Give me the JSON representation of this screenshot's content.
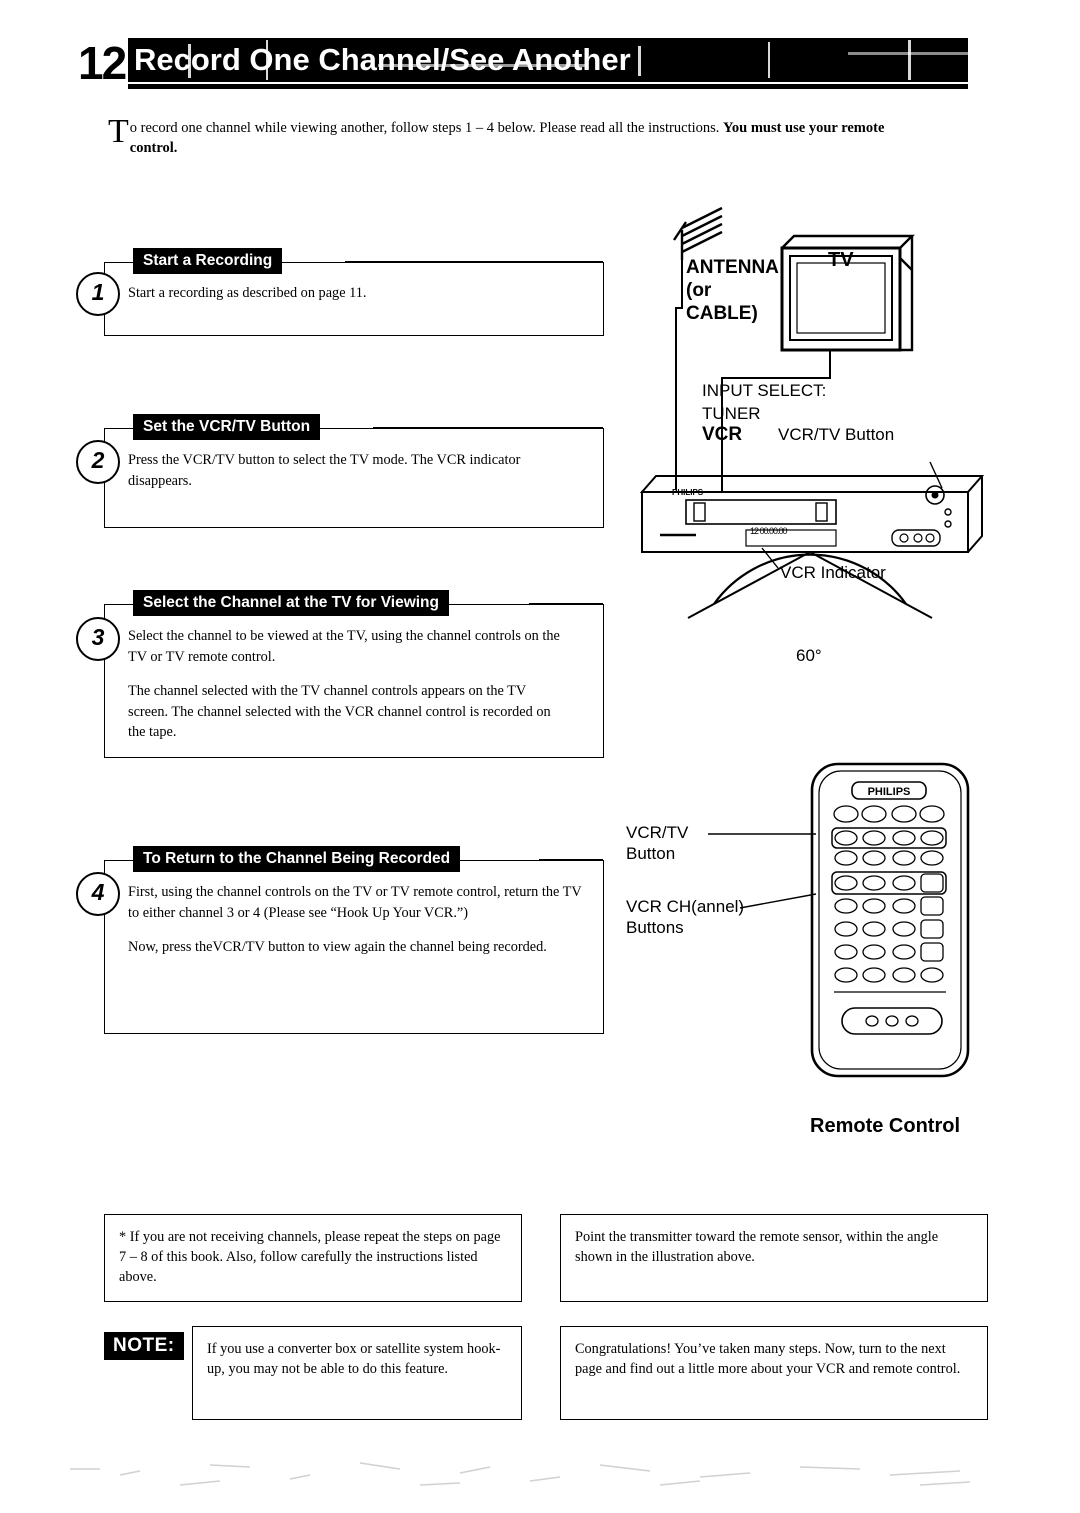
{
  "header": {
    "number": "12",
    "title": "Record One Channel/See Another"
  },
  "intro": {
    "dropcap": "T",
    "text_1": "o record one channel while viewing another, follow steps 1 ",
    "dash": "–",
    "text_2": " 4 below. Please read all the instructions. ",
    "bold_text": "You must use your remote control."
  },
  "steps": [
    {
      "number": "1",
      "title": "Start a Recording",
      "paragraphs": [
        "Start a recording as described on page 11."
      ]
    },
    {
      "number": "2",
      "title": "Set the VCR/TV Button",
      "paragraphs": [
        "Press the VCR/TV button to select the TV mode. The VCR indicator disappears."
      ]
    },
    {
      "number": "3",
      "title": "Select the Channel at the TV for Viewing",
      "paragraphs": [
        "Select the channel to be viewed at the TV, using the channel controls on the TV or TV remote control.",
        "The channel selected with the TV channel controls appears on the TV screen. The channel selected with the VCR channel control is recorded on the tape."
      ]
    },
    {
      "number": "4",
      "title": "To Return to the Channel Being Recorded",
      "paragraphs": [
        "First, using the channel controls on the TV or TV remote control, return the TV to either channel 3 or 4 (Please see “Hook Up Your VCR.”)",
        "Now, press theVCR/TV button to view again the channel being recorded."
      ]
    }
  ],
  "illustration": {
    "antenna_label_line1": "ANTENNA",
    "antenna_label_line2": "(or",
    "antenna_label_line3": "CABLE)",
    "tv_label": "TV",
    "input_select_line1": "INPUT SELECT:",
    "input_select_line2": "TUNER",
    "input_select_line3": "VCR",
    "vcrtv_button_label": "VCR/TV Button",
    "vcr_indicator_label": "VCR Indicator",
    "angle_label": "60°",
    "vcr_brand": "PHILIPS",
    "vcr_display": "12 00.00.00",
    "remote_brand": "PHILIPS",
    "remote_caption": "Remote Control",
    "callout_vcrtv_line1": "VCR/TV",
    "callout_vcrtv_line2": "Button",
    "callout_ch_line1": "VCR CH(annel)",
    "callout_ch_line2": "Buttons"
  },
  "notes": {
    "note_left_star": "* If you are not receiving channels, please repeat the steps on page 7 – 8 of this book. Also, follow carefully the instructions listed above.",
    "note_right_top": "Point the transmitter toward the remote sensor, within the angle shown in the illustration above.",
    "note_tag": "NOTE:",
    "note_left_bottom": "If you use a converter box or satellite system hook-up, you may not be able to do this feature.",
    "note_right_bottom": "Congratulations! You’ve taken many steps. Now, turn to the next page and find out a little more about your VCR and remote control."
  }
}
